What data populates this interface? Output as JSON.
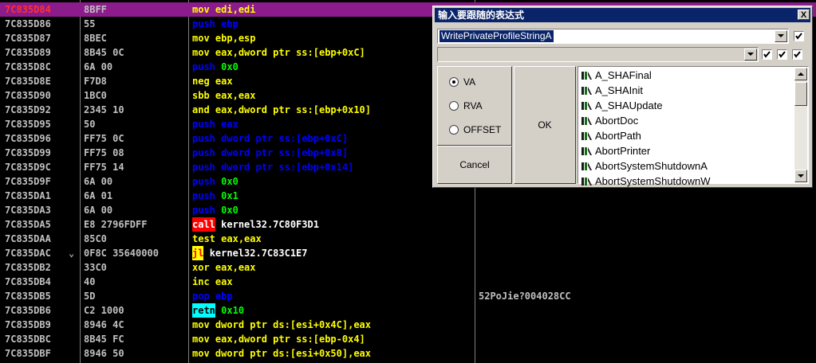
{
  "disasm": {
    "rows": [
      {
        "addr": "7C835D84",
        "mark": "",
        "hex": "8BFF",
        "op": "mov",
        "opnd": "edi,edi",
        "kind": "mov",
        "comment": ""
      },
      {
        "addr": "7C835D86",
        "mark": "",
        "hex": "55",
        "op": "push",
        "opnd": "ebp",
        "kind": "push",
        "comment": ""
      },
      {
        "addr": "7C835D87",
        "mark": "",
        "hex": "8BEC",
        "op": "mov",
        "opnd": "ebp,esp",
        "kind": "mov",
        "comment": ""
      },
      {
        "addr": "7C835D89",
        "mark": "",
        "hex": "8B45 0C",
        "op": "mov",
        "opnd": "eax,dword ptr ss:[ebp+0xC]",
        "kind": "mov",
        "comment": ""
      },
      {
        "addr": "7C835D8C",
        "mark": "",
        "hex": "6A 00",
        "op": "push",
        "opnd": "0x0",
        "kind": "push-imm",
        "comment": ""
      },
      {
        "addr": "7C835D8E",
        "mark": "",
        "hex": "F7D8",
        "op": "neg",
        "opnd": "eax",
        "kind": "other",
        "comment": ""
      },
      {
        "addr": "7C835D90",
        "mark": "",
        "hex": "1BC0",
        "op": "sbb",
        "opnd": "eax,eax",
        "kind": "other",
        "comment": ""
      },
      {
        "addr": "7C835D92",
        "mark": "",
        "hex": "2345 10",
        "op": "and",
        "opnd": "eax,dword ptr ss:[ebp+0x10]",
        "kind": "other",
        "comment": ""
      },
      {
        "addr": "7C835D95",
        "mark": "",
        "hex": "50",
        "op": "push",
        "opnd": "eax",
        "kind": "push",
        "comment": ""
      },
      {
        "addr": "7C835D96",
        "mark": "",
        "hex": "FF75 0C",
        "op": "push",
        "opnd": "dword ptr ss:[ebp+0xC]",
        "kind": "push",
        "comment": ""
      },
      {
        "addr": "7C835D99",
        "mark": "",
        "hex": "FF75 08",
        "op": "push",
        "opnd": "dword ptr ss:[ebp+0x8]",
        "kind": "push",
        "comment": ""
      },
      {
        "addr": "7C835D9C",
        "mark": "",
        "hex": "FF75 14",
        "op": "push",
        "opnd": "dword ptr ss:[ebp+0x14]",
        "kind": "push",
        "comment": ""
      },
      {
        "addr": "7C835D9F",
        "mark": "",
        "hex": "6A 00",
        "op": "push",
        "opnd": "0x0",
        "kind": "push-imm",
        "comment": ""
      },
      {
        "addr": "7C835DA1",
        "mark": "",
        "hex": "6A 01",
        "op": "push",
        "opnd": "0x1",
        "kind": "push-imm",
        "comment": ""
      },
      {
        "addr": "7C835DA3",
        "mark": "",
        "hex": "6A 00",
        "op": "push",
        "opnd": "0x0",
        "kind": "push-imm",
        "comment": ""
      },
      {
        "addr": "7C835DA5",
        "mark": "",
        "hex": "E8 2796FDFF",
        "op": "call",
        "opnd": "kernel32.7C80F3D1",
        "kind": "call",
        "comment": ""
      },
      {
        "addr": "7C835DAA",
        "mark": "",
        "hex": "85C0",
        "op": "test",
        "opnd": "eax,eax",
        "kind": "other",
        "comment": ""
      },
      {
        "addr": "7C835DAC",
        "mark": "⌄",
        "hex": "0F8C 35640000",
        "op": "jl",
        "opnd": "kernel32.7C83C1E7",
        "kind": "jl",
        "comment": ""
      },
      {
        "addr": "7C835DB2",
        "mark": "",
        "hex": "33C0",
        "op": "xor",
        "opnd": "eax,eax",
        "kind": "other",
        "comment": ""
      },
      {
        "addr": "7C835DB4",
        "mark": "",
        "hex": "40",
        "op": "inc",
        "opnd": "eax",
        "kind": "other",
        "comment": ""
      },
      {
        "addr": "7C835DB5",
        "mark": "",
        "hex": "5D",
        "op": "pop",
        "opnd": "ebp",
        "kind": "push",
        "comment": "52PoJie?004028CC"
      },
      {
        "addr": "7C835DB6",
        "mark": "",
        "hex": "C2 1000",
        "op": "retn",
        "opnd": "0x10",
        "kind": "retn",
        "comment": ""
      },
      {
        "addr": "7C835DB9",
        "mark": "",
        "hex": "8946 4C",
        "op": "mov",
        "opnd": "dword ptr ds:[esi+0x4C],eax",
        "kind": "mov",
        "comment": ""
      },
      {
        "addr": "7C835DBC",
        "mark": "",
        "hex": "8B45 FC",
        "op": "mov",
        "opnd": "eax,dword ptr ss:[ebp-0x4]",
        "kind": "mov",
        "comment": ""
      },
      {
        "addr": "7C835DBF",
        "mark": "",
        "hex": "8946 50",
        "op": "mov",
        "opnd": "dword ptr ds:[esi+0x50],eax",
        "kind": "mov",
        "comment": ""
      }
    ]
  },
  "dialog": {
    "title": "输入要跟随的表达式",
    "close_label": "X",
    "expression_value": "WritePrivateProfileStringA",
    "options": [
      {
        "label": "VA",
        "selected": true
      },
      {
        "label": "RVA",
        "selected": false
      },
      {
        "label": "OFFSET",
        "selected": false
      }
    ],
    "ok_label": "OK",
    "cancel_label": "Cancel",
    "functions": [
      "A_SHAFinal",
      "A_SHAInit",
      "A_SHAUpdate",
      "AbortDoc",
      "AbortPath",
      "AbortPrinter",
      "AbortSystemShutdownA",
      "AbortSystemShutdownW"
    ],
    "function_icon": "module-function-icon",
    "checkboxes_checked": [
      true,
      true,
      true,
      true
    ]
  },
  "colors": {
    "background": "#000000",
    "selected_row": "#8c1b8c",
    "mnemonic": "#ffff00",
    "push": "#0000ff",
    "immediate": "#00ff00",
    "call_bg": "#ff0000",
    "jl_bg": "#ffff00",
    "retn_bg": "#00ffff",
    "dialog_bg": "#d4d0c8",
    "titlebar": "#0a246a"
  }
}
